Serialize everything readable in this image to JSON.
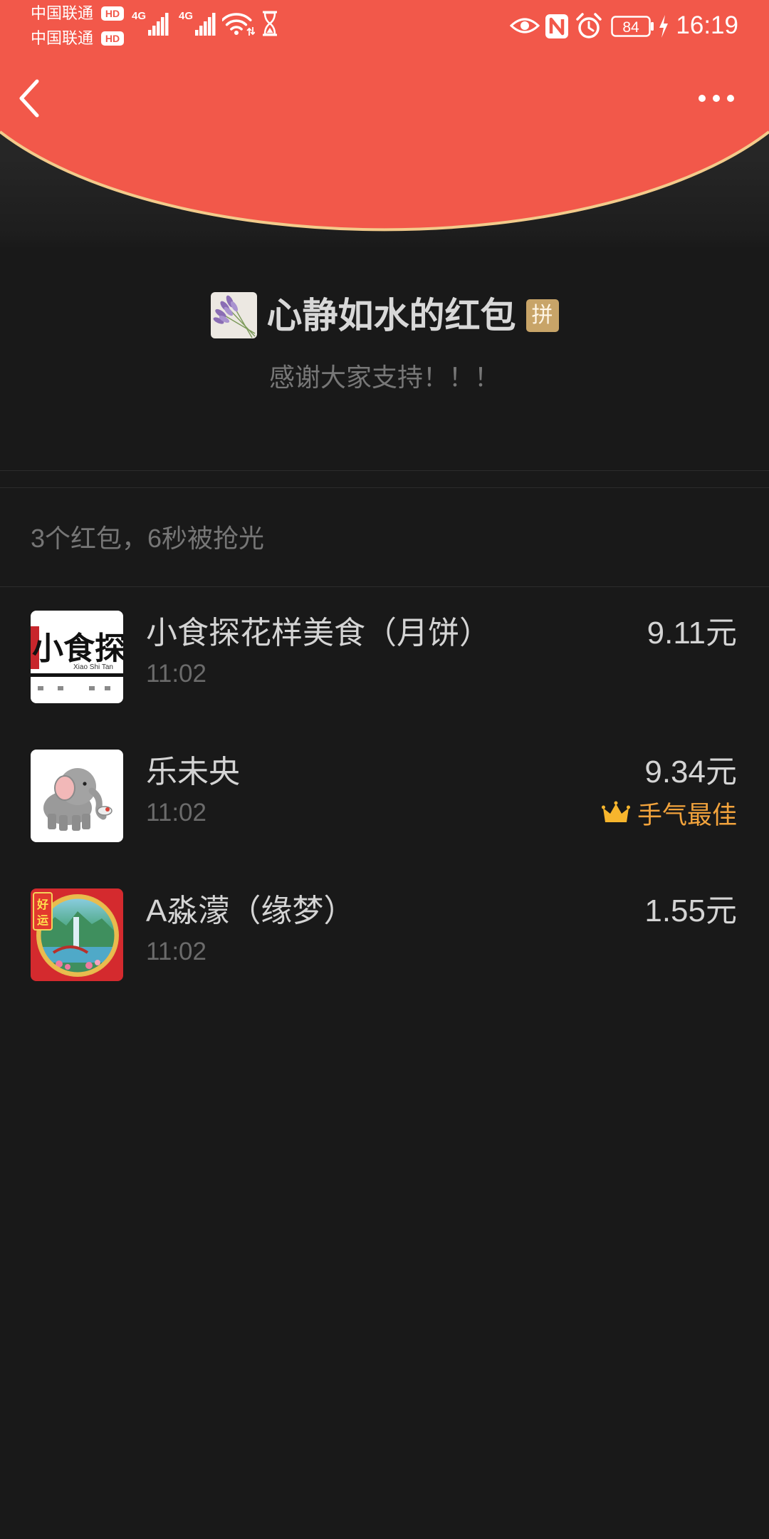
{
  "status_bar": {
    "carrier_1": "中国联通",
    "carrier_2": "中国联通",
    "hd_1": "HD",
    "hd_2": "HD",
    "network_1": "4G",
    "network_2": "4G",
    "battery": "84",
    "time": "16:19",
    "icons": [
      "signal-icon",
      "wifi-icon",
      "hourglass-icon",
      "eye-icon",
      "nfc-icon",
      "alarm-icon",
      "battery-icon",
      "charging-icon"
    ]
  },
  "header": {
    "back_icon": "back-arrow-icon",
    "more_icon": "more-dots-icon"
  },
  "packet": {
    "sender_title": "心静如水的红包",
    "badge": "拼",
    "message": "感谢大家支持！！！"
  },
  "summary": {
    "text": "3个红包，6秒被抢光"
  },
  "recipients": [
    {
      "name": "小食探花样美食（月饼）",
      "time": "11:02",
      "amount": "9.11元",
      "avatar_lettering": [
        "小食探",
        "Xiao Shi Tan"
      ]
    },
    {
      "name": "乐未央",
      "time": "11:02",
      "amount": "9.34元",
      "best_luck": "手气最佳",
      "best_luck_icon": "crown-icon"
    },
    {
      "name": "A淼濛（缘梦）",
      "time": "11:02",
      "amount": "1.55元",
      "avatar_lettering": [
        "好",
        "运"
      ]
    }
  ],
  "colors": {
    "header_red": "#F2584A",
    "background": "#191919",
    "best_luck": "#F2A33C",
    "badge_gold": "#C8A468",
    "arc_border": "#F3CB8B"
  }
}
